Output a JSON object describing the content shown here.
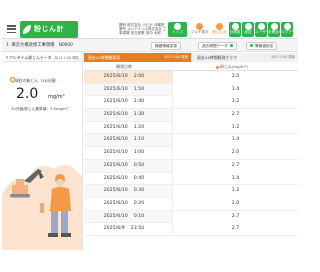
{
  "header": {
    "app_logo": "粉じん計",
    "company_text": "関西 株式会社 パピポ 沖縄営業所 メンテナンス株式会社 工事現場 担当営業 田中 太郎",
    "toolbar": [
      {
        "label": "トップ",
        "style": "green",
        "icon": "home-icon"
      },
      {
        "label": "マルチ表示",
        "style": "white",
        "icon": "grid-icon"
      },
      {
        "label": "粉じん計",
        "style": "orange",
        "icon": "dust-icon"
      },
      {
        "label": "計測表",
        "style": "green",
        "icon": "table-icon"
      },
      {
        "label": "設定",
        "style": "green",
        "icon": "gear-icon"
      },
      {
        "label": "ユーザー",
        "style": "green",
        "icon": "user-icon"
      },
      {
        "label": "お問合せ",
        "style": "green",
        "icon": "mail-icon"
      },
      {
        "label": "ログアウト",
        "style": "green",
        "icon": "logout-icon"
      }
    ]
  },
  "subheader": {
    "site_name": "1. 東京大橋改修工事現場　N0000",
    "btn_edit": "機器情報変更",
    "btn_past": "過去期間データ",
    "btn_alert": "警報値設定"
  },
  "left": {
    "title": "リアルタイム粉じんデータ",
    "time": "8/13 2:00 現在",
    "current_label": "現在の粉じん（10分値）",
    "value": "2.0",
    "unit": "mg/m³",
    "caption": "10分値/粉じん基準値：3.0mg/m³"
  },
  "right": {
    "tab_active": "過去24時間観測表",
    "tab_active_time": "8/13 2:00 更新",
    "tab_inactive": "過去24時間観測グラフ",
    "tab_inactive_time": "8/13 2:00 更新",
    "col_datetime": "観測日時",
    "col_value": "粉じん(mg/m³)",
    "rows": [
      {
        "date": "2025/6/10",
        "time": "2:00",
        "value": "2.0"
      },
      {
        "date": "2025/6/10",
        "time": "1:50",
        "value": "1.4"
      },
      {
        "date": "2025/6/10",
        "time": "1:40",
        "value": "1.2"
      },
      {
        "date": "2025/6/10",
        "time": "1:30",
        "value": "2.7"
      },
      {
        "date": "2025/6/10",
        "time": "1:20",
        "value": "1.2"
      },
      {
        "date": "2025/6/10",
        "time": "1:10",
        "value": "1.4"
      },
      {
        "date": "2025/6/10",
        "time": "1:00",
        "value": "2.0"
      },
      {
        "date": "2025/6/10",
        "time": "0:50",
        "value": "2.7"
      },
      {
        "date": "2025/6/10",
        "time": "0:40",
        "value": "1.4"
      },
      {
        "date": "2025/6/10",
        "time": "0:30",
        "value": "1.2"
      },
      {
        "date": "2025/6/10",
        "time": "0:20",
        "value": "2.0"
      },
      {
        "date": "2025/6/10",
        "time": "0:10",
        "value": "2.7"
      },
      {
        "date": "2025/6/9",
        "time": "23:50",
        "value": "2.7"
      }
    ]
  },
  "colors": {
    "accent": "#e87d1e",
    "brand": "#2db34a",
    "highlight": "#fde8d6"
  }
}
